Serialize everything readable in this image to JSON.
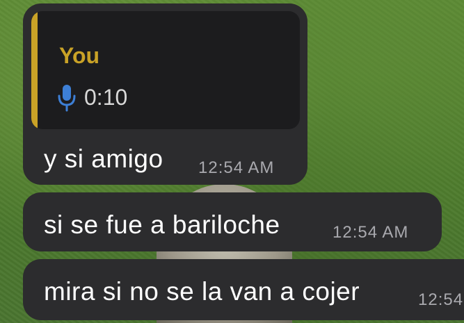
{
  "colors": {
    "bubble": "#2c2c2e",
    "reply_background": "#1c1c1e",
    "reply_accent": "#c9a227",
    "mic_icon": "#3d7fd6",
    "timestamp": "#a9a9ae",
    "message_text": "#ffffff"
  },
  "messages": [
    {
      "reply": {
        "sender": "You",
        "icon": "microphone-icon",
        "duration": "0:10"
      },
      "text": "y si amigo",
      "time": "12:54 AM"
    },
    {
      "text": "si se fue a bariloche",
      "time": "12:54 AM"
    },
    {
      "text": "mira si no se la van a cojer",
      "time": "12:54"
    }
  ]
}
